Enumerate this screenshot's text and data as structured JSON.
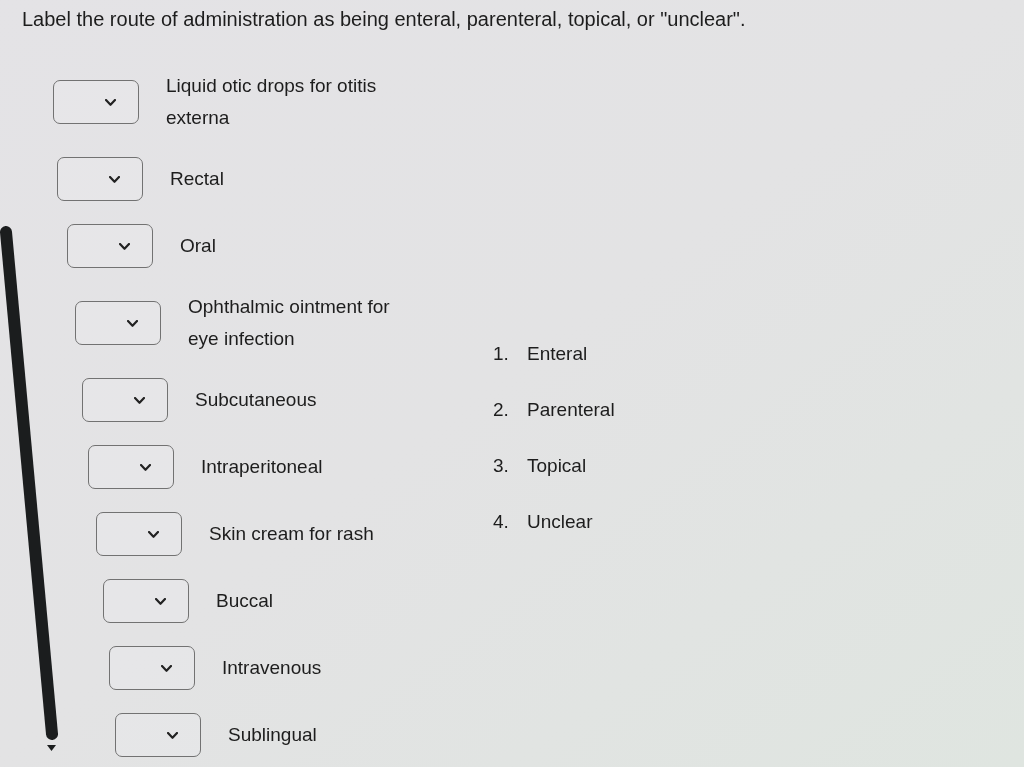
{
  "instruction": "Label the route of administration as being enteral, parenteral, topical, or \"unclear\".",
  "items": [
    {
      "label": "Liquid otic drops for otitis externa"
    },
    {
      "label": "Rectal"
    },
    {
      "label": "Oral"
    },
    {
      "label": "Ophthalmic ointment for eye infection"
    },
    {
      "label": "Subcutaneous"
    },
    {
      "label": "Intraperitoneal"
    },
    {
      "label": "Skin cream for rash"
    },
    {
      "label": "Buccal"
    },
    {
      "label": "Intravenous"
    },
    {
      "label": "Sublingual"
    }
  ],
  "options": [
    {
      "number": "1.",
      "label": "Enteral"
    },
    {
      "number": "2.",
      "label": "Parenteral"
    },
    {
      "number": "3.",
      "label": "Topical"
    },
    {
      "number": "4.",
      "label": "Unclear"
    }
  ]
}
